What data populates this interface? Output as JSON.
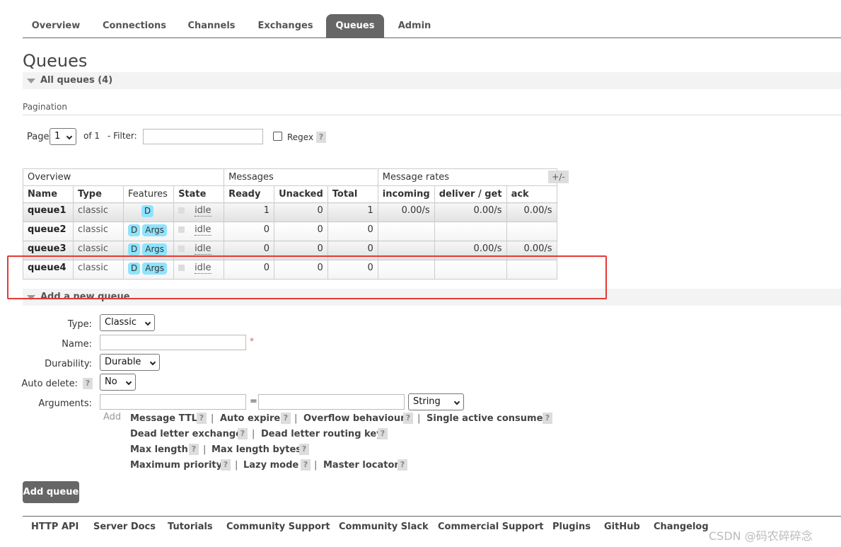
{
  "nav": {
    "tabs": [
      "Overview",
      "Connections",
      "Channels",
      "Exchanges",
      "Queues",
      "Admin"
    ],
    "active": "Queues"
  },
  "page_title": "Queues",
  "all_queues": {
    "label": "All queues (4)"
  },
  "pagination": {
    "label": "Pagination",
    "page_label": "Page",
    "page_value": "1",
    "of_label": "of 1",
    "filter_label": "- Filter:",
    "filter_value": "",
    "regex_label": "Regex",
    "help": "?"
  },
  "table": {
    "groups": [
      "Overview",
      "Messages",
      "Message rates"
    ],
    "plus_minus": "+/-",
    "columns": [
      "Name",
      "Type",
      "Features",
      "State",
      "Ready",
      "Unacked",
      "Total",
      "incoming",
      "deliver / get",
      "ack"
    ],
    "rows": [
      {
        "name": "queue1",
        "type": "classic",
        "f1": "D",
        "f2": "",
        "state": "idle",
        "ready": "1",
        "unacked": "0",
        "total": "1",
        "incoming": "0.00/s",
        "deliver": "0.00/s",
        "ack": "0.00/s"
      },
      {
        "name": "queue2",
        "type": "classic",
        "f1": "D",
        "f2": "Args",
        "state": "idle",
        "ready": "0",
        "unacked": "0",
        "total": "0",
        "incoming": "",
        "deliver": "",
        "ack": ""
      },
      {
        "name": "queue3",
        "type": "classic",
        "f1": "D",
        "f2": "Args",
        "state": "idle",
        "ready": "0",
        "unacked": "0",
        "total": "0",
        "incoming": "",
        "deliver": "0.00/s",
        "ack": "0.00/s"
      },
      {
        "name": "queue4",
        "type": "classic",
        "f1": "D",
        "f2": "Args",
        "state": "idle",
        "ready": "0",
        "unacked": "0",
        "total": "0",
        "incoming": "",
        "deliver": "",
        "ack": ""
      }
    ]
  },
  "add_queue": {
    "section_label": "Add a new queue",
    "type_label": "Type:",
    "type_value": "Classic",
    "name_label": "Name:",
    "name_value": "",
    "required_mark": "*",
    "durability_label": "Durability:",
    "durability_value": "Durable",
    "auto_delete_label": "Auto delete:",
    "auto_delete_value": "No",
    "arguments_label": "Arguments:",
    "equals": "=",
    "arg_type_value": "String",
    "add_label": "Add",
    "arg_links": {
      "message_ttl": "Message TTL",
      "auto_expire": "Auto expire",
      "overflow_behaviour": "Overflow behaviour",
      "single_active_consumer": "Single active consumer",
      "dead_letter_exchange": "Dead letter exchange",
      "dead_letter_routing_key": "Dead letter routing key",
      "max_length": "Max length",
      "max_length_bytes": "Max length bytes",
      "maximum_priority": "Maximum priority",
      "lazy_mode": "Lazy mode",
      "master_locator": "Master locator"
    },
    "separator": "|",
    "button_label": "Add queue"
  },
  "footer": {
    "links": [
      "HTTP API",
      "Server Docs",
      "Tutorials",
      "Community Support",
      "Community Slack",
      "Commercial Support",
      "Plugins",
      "GitHub",
      "Changelog"
    ]
  },
  "watermark": "CSDN @码农碎碎念",
  "colors": {
    "highlight": "#e53935",
    "badge": "#8ee3ff",
    "nav_active": "#666666"
  }
}
